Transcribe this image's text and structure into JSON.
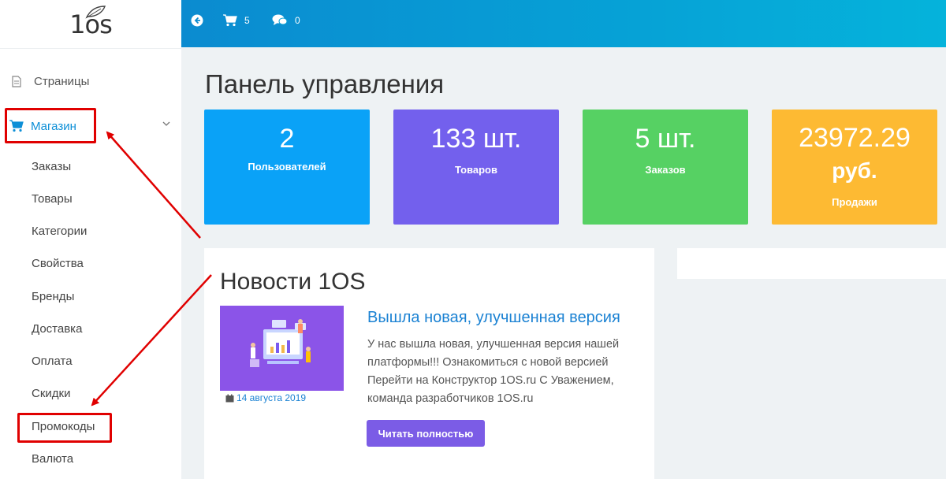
{
  "logo": {
    "text": "1os"
  },
  "topbar": {
    "cart_count": "5",
    "messages_count": "0"
  },
  "sidebar": {
    "pages_label": "Страницы",
    "shop_label": "Магазин",
    "shop_items": [
      "Заказы",
      "Товары",
      "Категории",
      "Свойства",
      "Бренды",
      "Доставка",
      "Оплата",
      "Скидки",
      "Промокоды",
      "Валюта"
    ]
  },
  "main": {
    "title": "Панель управления",
    "stats": [
      {
        "value": "2",
        "caption": "Пользователей",
        "color": "#0aa2f7"
      },
      {
        "value": "133 шт.",
        "caption": "Товаров",
        "color": "#7360ed"
      },
      {
        "value": "5 шт.",
        "caption": "Заказов",
        "color": "#56d163"
      },
      {
        "value": "23972.29",
        "unit": "руб.",
        "caption": "Продажи",
        "color": "#fdba33"
      }
    ],
    "news": {
      "title": "Новости 1OS",
      "date": "14 августа 2019",
      "article_title": "Вышла новая, улучшенная версия",
      "article_body": "У нас вышла новая, улучшенная версия нашей платформы!!! Ознакомиться с новой версией Перейти на Конструктор 1OS.ru С Уважением, команда разработчиков 1OS.ru",
      "read_more": "Читать полностью"
    }
  },
  "colors": {
    "accent": "#0d8fd7",
    "highlight": "#e00000",
    "button": "#7b5ce6"
  }
}
